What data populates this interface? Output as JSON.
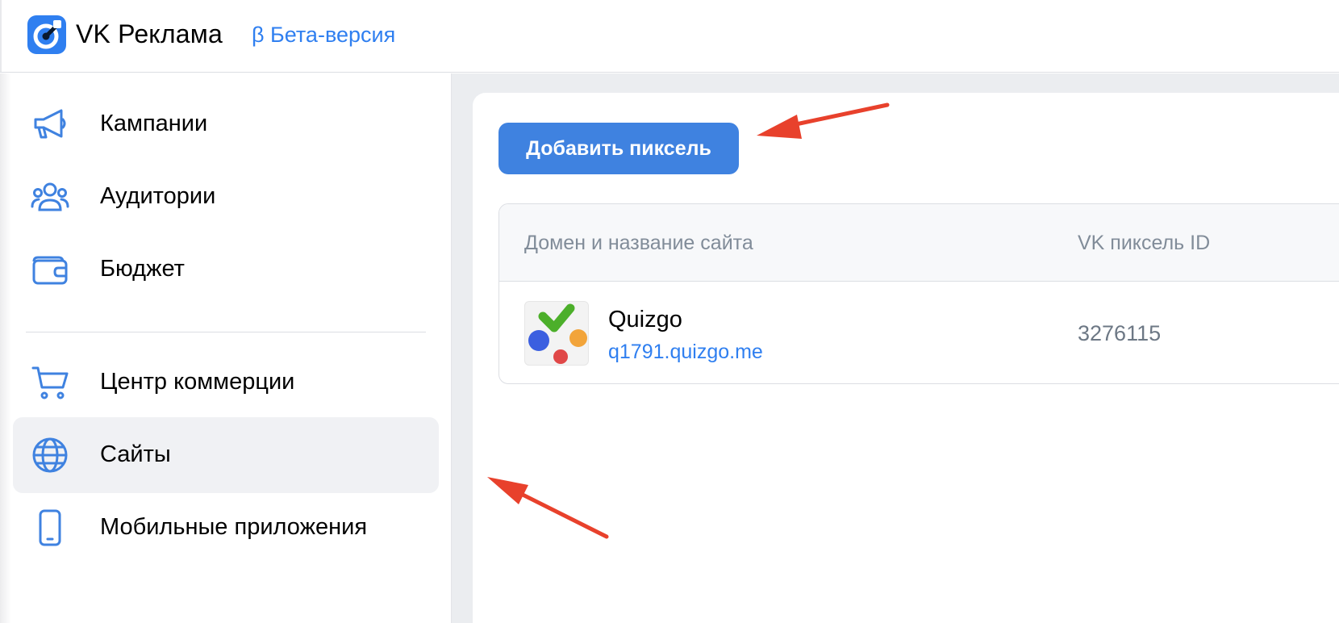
{
  "header": {
    "brand": "VK Реклама",
    "beta_label": "β Бета-версия",
    "logo_icon": "vk-ads-logo-icon",
    "accent_color": "#2f7ff0"
  },
  "sidebar": {
    "items": [
      {
        "label": "Кампании",
        "icon": "megaphone-icon",
        "active": false
      },
      {
        "label": "Аудитории",
        "icon": "users-group-icon",
        "active": false
      },
      {
        "label": "Бюджет",
        "icon": "wallet-icon",
        "active": false
      },
      {
        "label": "Центр коммерции",
        "icon": "shopping-cart-icon",
        "active": false
      },
      {
        "label": "Сайты",
        "icon": "globe-icon",
        "active": true
      },
      {
        "label": "Мобильные приложения",
        "icon": "smartphone-icon",
        "active": false
      }
    ]
  },
  "main": {
    "add_button_label": "Добавить пиксель",
    "table": {
      "columns": [
        "Домен и название сайта",
        "VK пиксель ID"
      ],
      "rows": [
        {
          "site_name": "Quizgo",
          "domain": "q1791.quizgo.me",
          "pixel_id": "3276115",
          "icon": "quizgo-logo-icon"
        }
      ]
    }
  },
  "annotations": {
    "arrow_color": "#e8412c",
    "arrows": [
      "arrow-to-add-pixel-button",
      "arrow-to-sites-nav-item"
    ]
  }
}
